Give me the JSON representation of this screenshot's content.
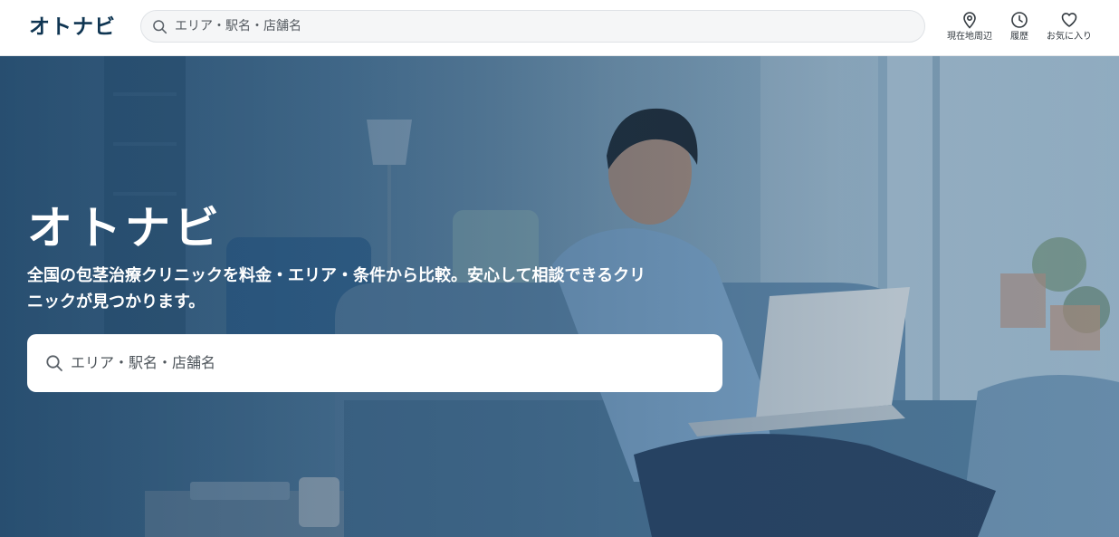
{
  "header": {
    "logo": "オトナビ",
    "search": {
      "placeholder": "エリア・駅名・店舗名",
      "icon": "search-icon"
    },
    "nav": [
      {
        "label": "現在地周辺",
        "icon": "location-pin-icon"
      },
      {
        "label": "履歴",
        "icon": "clock-icon"
      },
      {
        "label": "お気に入り",
        "icon": "heart-icon"
      }
    ]
  },
  "hero": {
    "title": "オトナビ",
    "subtitle": "全国の包茎治療クリニックを料金・エリア・条件から比較。安心して相談できるクリニックが見つかります。",
    "search": {
      "placeholder": "エリア・駅名・店舗名",
      "icon": "search-icon"
    },
    "image": "man-with-laptop-on-sofa-photo"
  },
  "colors": {
    "brand": "#0f3552",
    "hero_overlay": "#1e4a70",
    "text_on_hero": "#ffffff"
  }
}
